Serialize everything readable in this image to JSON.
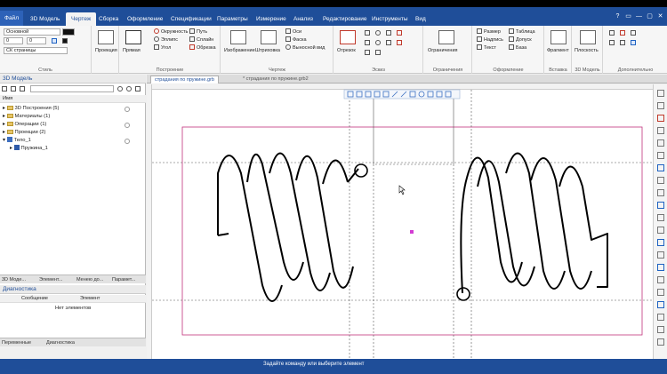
{
  "tabs": {
    "file": "Файл",
    "items": [
      "3D Модель",
      "Чертеж",
      "Сборка",
      "Оформление",
      "Спецификации",
      "Параметры",
      "Измерение",
      "Анализ",
      "Редактирование",
      "Инструменты",
      "Вид"
    ],
    "active": "Чертеж"
  },
  "window_controls": [
    "?",
    "▭",
    "—",
    "▢",
    "✕"
  ],
  "ribbon": {
    "style": {
      "label": "Стиль",
      "combo_style": "Основной",
      "combo_a": "0",
      "combo_b": "0",
      "combo_layer": "СК страницы"
    },
    "projection": {
      "button": "Проекция"
    },
    "geometry": {
      "label": "Построение",
      "items": [
        "Прямая",
        "Окружность",
        "Путь",
        "Эллипс",
        "Сплайн",
        "Угол",
        "Обрезка"
      ]
    },
    "draw": {
      "items": [
        "Изображение",
        "Штриховка"
      ],
      "small": [
        "Оси",
        "Фаска",
        "Выносной вид"
      ],
      "label": "Чертеж"
    },
    "sketch": {
      "button": "Отрезок",
      "label": "Эскиз"
    },
    "constraints": {
      "button": "Ограничения",
      "label": "Ограничения"
    },
    "annotation": {
      "label": "Оформление",
      "items": [
        "Размер",
        "Надпись",
        "Текст",
        "Таблица",
        "Допуск",
        "База"
      ]
    },
    "insert": {
      "button": "Фрагмент",
      "label": "Вставка"
    },
    "model3d": {
      "button": "Плоскость",
      "label": "3D Модель"
    },
    "extra": {
      "label": "Дополнительно"
    }
  },
  "left_panel": {
    "title": "3D Модель",
    "column": "Имя",
    "tree": [
      {
        "label": "3D Построения (5)",
        "icon": "folder-icon"
      },
      {
        "label": "Материалы (1)",
        "icon": "folder-icon"
      },
      {
        "label": "Операции (1)",
        "icon": "folder-icon"
      },
      {
        "label": "Проекции (2)",
        "icon": "folder-icon"
      },
      {
        "label": "Тело_1",
        "icon": "body-icon"
      },
      {
        "label": "Пружина_1",
        "icon": "spring-icon"
      }
    ],
    "tabs": [
      "3D Моде...",
      "Элемент...",
      "Менею до...",
      "Парамет..."
    ],
    "diag_title": "Диагностика",
    "diag_cols": [
      "Сообщение",
      "Элемент"
    ],
    "diag_empty": "Нет элементов",
    "bottom_tabs": [
      "Переменные",
      "Диагностика"
    ]
  },
  "document_tabs": [
    "страдания по пружине.grb",
    "* страдания по пружине.grb2"
  ],
  "status": {
    "text": "Задайте команду или выберите элемент"
  },
  "colors": {
    "brand": "#1f4e99",
    "frame": "#c2327c",
    "ribbon": "#f6f6f6"
  }
}
